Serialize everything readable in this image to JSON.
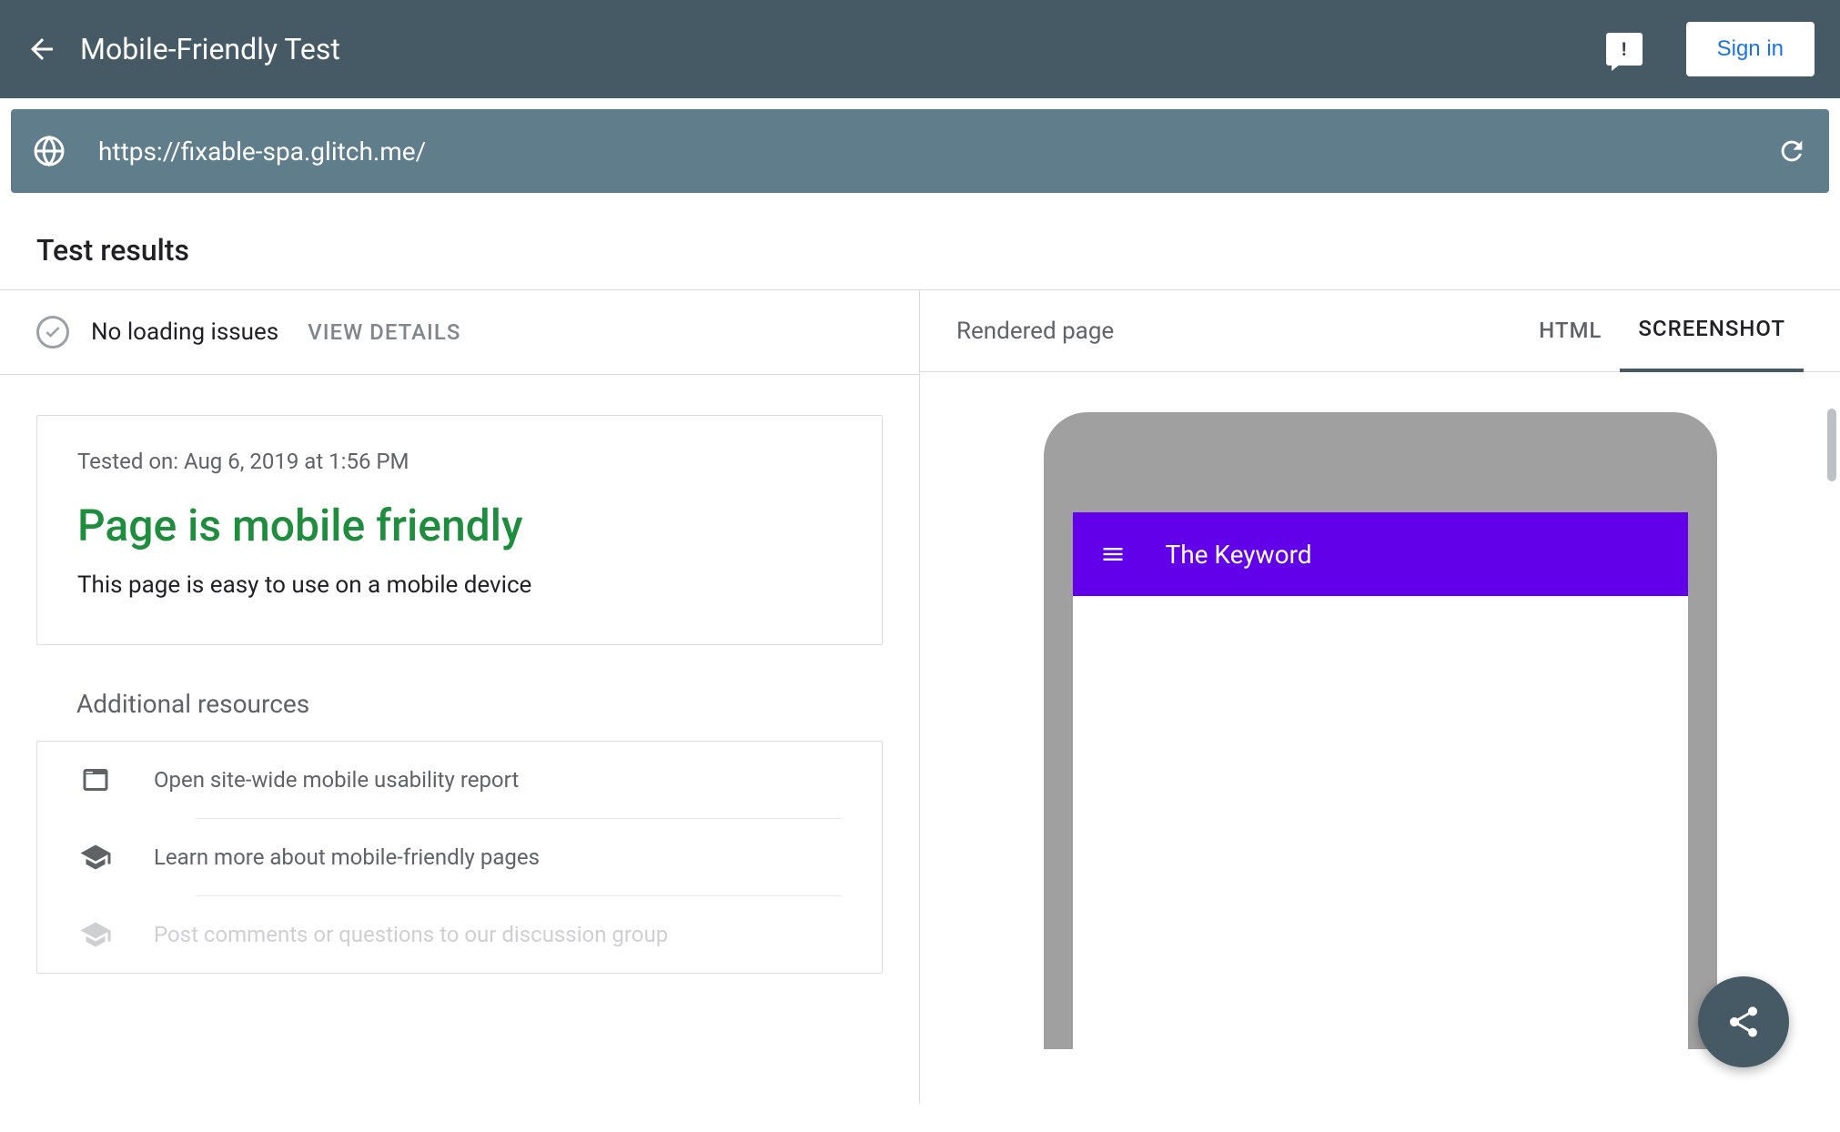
{
  "header": {
    "title": "Mobile-Friendly Test",
    "signin_label": "Sign in"
  },
  "url_bar": {
    "url": "https://fixable-spa.glitch.me/"
  },
  "section": {
    "title": "Test results"
  },
  "status": {
    "text": "No loading issues",
    "view_details": "VIEW DETAILS"
  },
  "result": {
    "tested_on": "Tested on: Aug 6, 2019 at 1:56 PM",
    "heading": "Page is mobile friendly",
    "subtitle": "This page is easy to use on a mobile device"
  },
  "resources": {
    "title": "Additional resources",
    "items": [
      "Open site-wide mobile usability report",
      "Learn more about mobile-friendly pages",
      "Post comments or questions to our discussion group"
    ]
  },
  "right": {
    "rendered_label": "Rendered page",
    "tabs": {
      "html": "HTML",
      "screenshot": "SCREENSHOT"
    }
  },
  "phone": {
    "title": "The Keyword"
  }
}
